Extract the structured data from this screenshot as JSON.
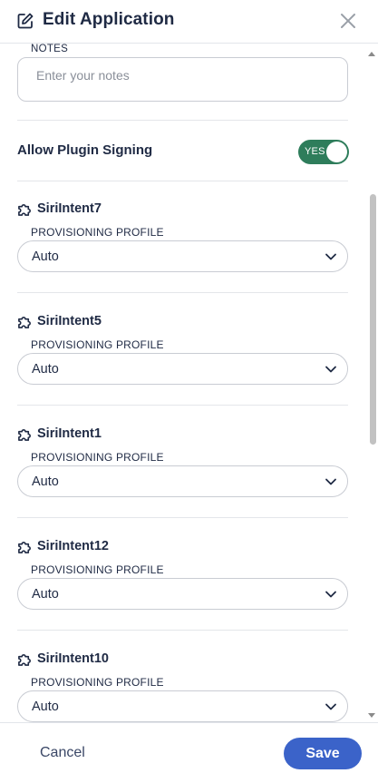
{
  "header": {
    "title": "Edit Application",
    "edit_icon": "edit-icon",
    "close_icon": "close-icon"
  },
  "notes": {
    "label": "NOTES",
    "placeholder": "Enter your notes",
    "value": ""
  },
  "plugin_signing": {
    "label": "Allow Plugin Signing",
    "toggle_text": "YES",
    "enabled": true
  },
  "plugins": [
    {
      "name": "SiriIntent7",
      "profile_label": "PROVISIONING PROFILE",
      "profile_value": "Auto"
    },
    {
      "name": "SiriIntent5",
      "profile_label": "PROVISIONING PROFILE",
      "profile_value": "Auto"
    },
    {
      "name": "SiriIntent1",
      "profile_label": "PROVISIONING PROFILE",
      "profile_value": "Auto"
    },
    {
      "name": "SiriIntent12",
      "profile_label": "PROVISIONING PROFILE",
      "profile_value": "Auto"
    },
    {
      "name": "SiriIntent10",
      "profile_label": "PROVISIONING PROFILE",
      "profile_value": "Auto"
    }
  ],
  "footer": {
    "cancel_label": "Cancel",
    "save_label": "Save"
  },
  "colors": {
    "toggle_on": "#2e7d5b",
    "save_button": "#3b63c9",
    "text_primary": "#1f2a44"
  }
}
